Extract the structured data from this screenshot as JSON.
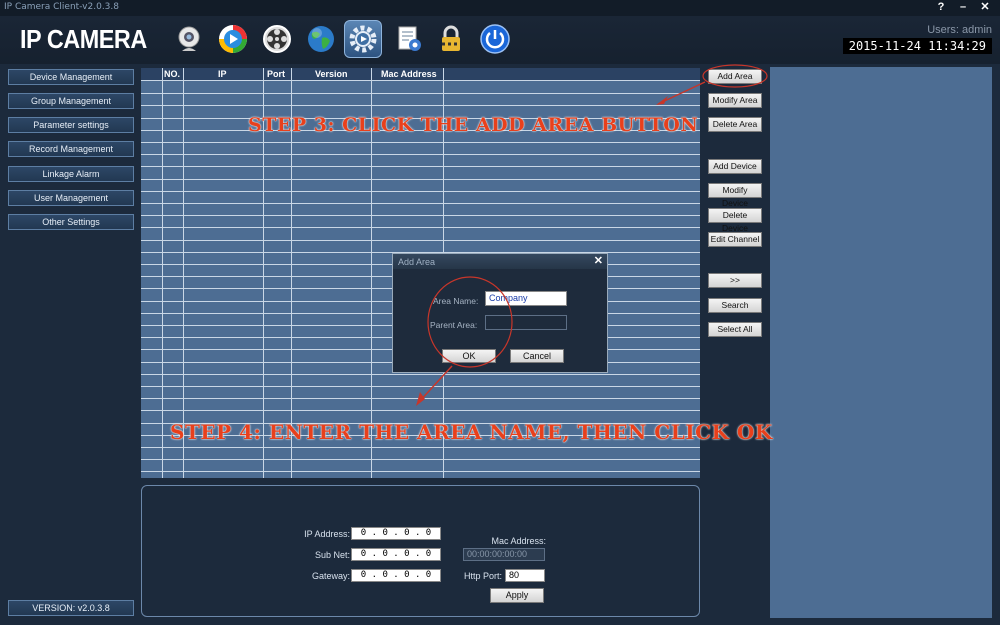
{
  "window": {
    "title": "IP Camera Client-v2.0.3.8",
    "buttons": [
      "?",
      "–",
      "✕"
    ]
  },
  "header": {
    "logo": "IP CAMERA",
    "users": "Users: admin",
    "clock": "2015-11-24  11:34:29",
    "toolbar_icons": [
      "webcam-icon",
      "play-icon",
      "film-reel-icon",
      "globe-icon",
      "settings-icon",
      "document-settings-icon",
      "lock-icon",
      "power-icon"
    ]
  },
  "sidebar": {
    "items": [
      {
        "label": "Device Management"
      },
      {
        "label": "Group Management"
      },
      {
        "label": "Parameter settings"
      },
      {
        "label": "Record Management"
      },
      {
        "label": "Linkage Alarm"
      },
      {
        "label": "User Management"
      },
      {
        "label": "Other Settings"
      }
    ],
    "version": "VERSION: v2.0.3.8"
  },
  "table": {
    "columns": [
      "NO.",
      "IP",
      "Port",
      "Version",
      "Mac Address"
    ]
  },
  "actions": {
    "add_area": "Add Area",
    "modify_area": "Modify Area",
    "delete_area": "Delete Area",
    "add_device": "Add Device",
    "modify_device": "Modify Device",
    "delete_device": "Delete Device",
    "edit_channel": "Edit Channel",
    "more": ">>",
    "search": "Search",
    "select_all": "Select All"
  },
  "info": {
    "ip_label": "IP Address:",
    "ip_value": "0 . 0 . 0 . 0",
    "subnet_label": "Sub Net:",
    "subnet_value": "0 . 0 . 0 . 0",
    "gateway_label": "Gateway:",
    "gateway_value": "0 . 0 . 0 . 0",
    "mac_label": "Mac Address:",
    "mac_value": "00:00:00:00:00",
    "http_label": "Http Port:",
    "http_value": "80",
    "apply": "Apply"
  },
  "dialog": {
    "title": "Add Area",
    "close": "✕",
    "area_name_label": "Area Name:",
    "area_name_value": "Company",
    "parent_area_label": "Parent Area:",
    "parent_area_value": "",
    "ok": "OK",
    "cancel": "Cancel"
  },
  "annotations": {
    "step3": "STEP 3: CLICK THE ADD AREA BUTTON",
    "step4": "STEP 4: ENTER THE AREA NAME, THEN CLICK OK",
    "color": "#e8401c"
  }
}
